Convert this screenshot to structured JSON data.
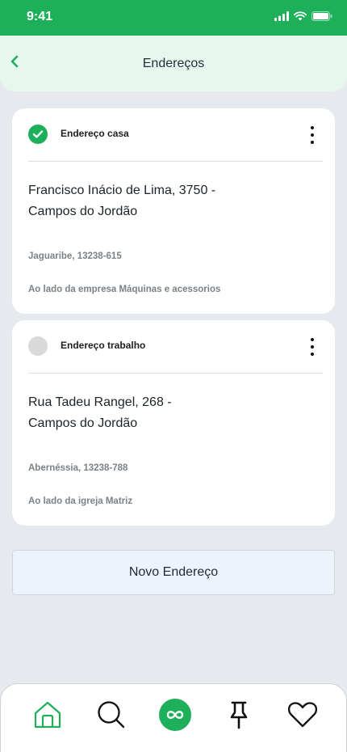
{
  "status_bar": {
    "time": "9:41"
  },
  "header": {
    "title": "Endereços"
  },
  "addresses": [
    {
      "label": "Endereço casa",
      "selected": true,
      "street_line1": "Francisco Inácio de Lima, 3750 -",
      "street_line2": "Campos do Jordão",
      "district": "Jaguaribe, 13238-615",
      "reference": "Ao lado da empresa Máquinas e acessorios"
    },
    {
      "label": "Endereço trabalho",
      "selected": false,
      "street_line1": "Rua Tadeu Rangel,  268 -",
      "street_line2": "Campos do Jordão",
      "district": "Abernéssia, 13238-788",
      "reference": "Ao lado da igreja Matriz"
    }
  ],
  "new_address_button": {
    "label": "Novo Endereço"
  },
  "bottom_nav": [
    {
      "icon": "home-icon",
      "active": true
    },
    {
      "icon": "search-icon",
      "active": false
    },
    {
      "icon": "infinity-icon",
      "active": false
    },
    {
      "icon": "pin-icon",
      "active": false
    },
    {
      "icon": "heart-icon",
      "active": false
    }
  ],
  "colors": {
    "primary": "#1daf5a",
    "header_bg": "#e6f8ee",
    "page_bg": "#e6eaee",
    "button_bg": "#eef3fb"
  }
}
